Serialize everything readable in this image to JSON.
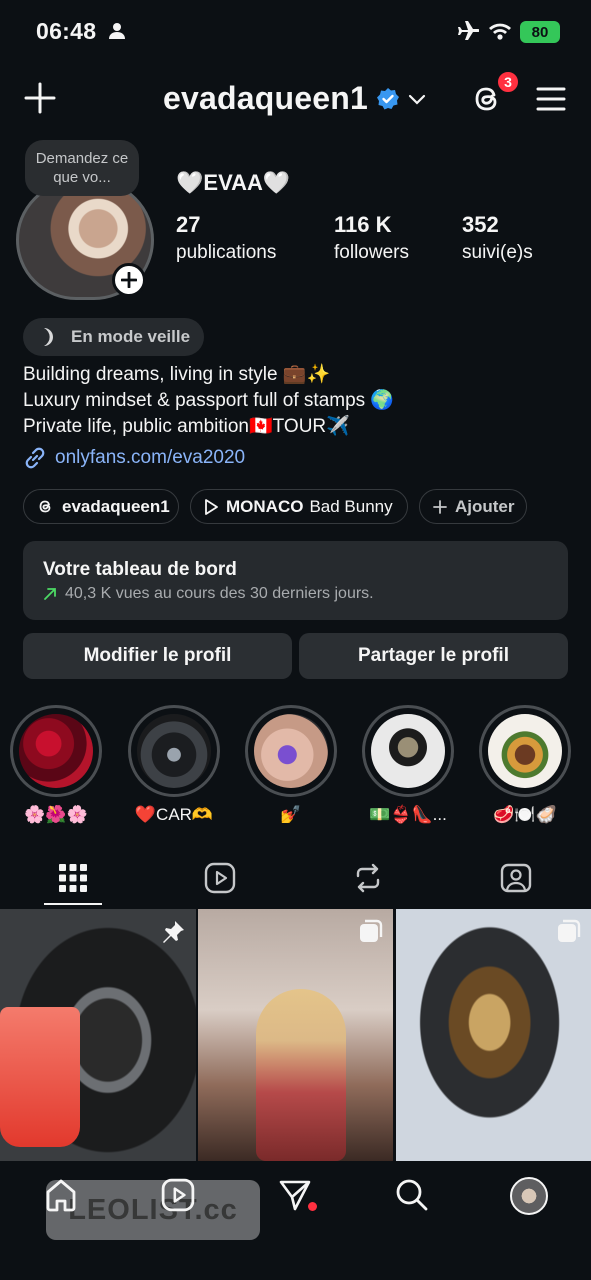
{
  "status_bar": {
    "time": "06:48",
    "battery": "80"
  },
  "header": {
    "username": "evadaqueen1",
    "threads_badge": "3"
  },
  "profile": {
    "note": "Demandez ce que vo...",
    "display_name": "🤍EVAA🤍",
    "stats": [
      {
        "value": "27",
        "label": "publications"
      },
      {
        "value": "116 K",
        "label": "followers"
      },
      {
        "value": "352",
        "label": "suivi(e)s"
      }
    ],
    "sleep_mode": "En mode veille",
    "bio_lines": [
      "Building dreams, living in style 💼✨",
      "Luxury mindset & passport full of stamps 🌍",
      "Private life, public ambition🇨🇦TOUR✈️"
    ],
    "link": "onlyfans.com/eva2020"
  },
  "chips": {
    "threads": "evadaqueen1",
    "music_title": "MONACO",
    "music_artist": "Bad Bunny",
    "add": "Ajouter"
  },
  "dashboard": {
    "title": "Votre tableau de bord",
    "subtitle": "40,3 K vues au cours des 30 derniers jours."
  },
  "buttons": {
    "edit": "Modifier le profil",
    "share": "Partager le profil"
  },
  "highlights": [
    {
      "label": "🌸🌺🌸"
    },
    {
      "label": "❤️CAR🫶"
    },
    {
      "label": "💅"
    },
    {
      "label": "💵👙👠..."
    },
    {
      "label": "🥩🍽️🦪"
    }
  ],
  "watermark": "LEOLIST.cc"
}
